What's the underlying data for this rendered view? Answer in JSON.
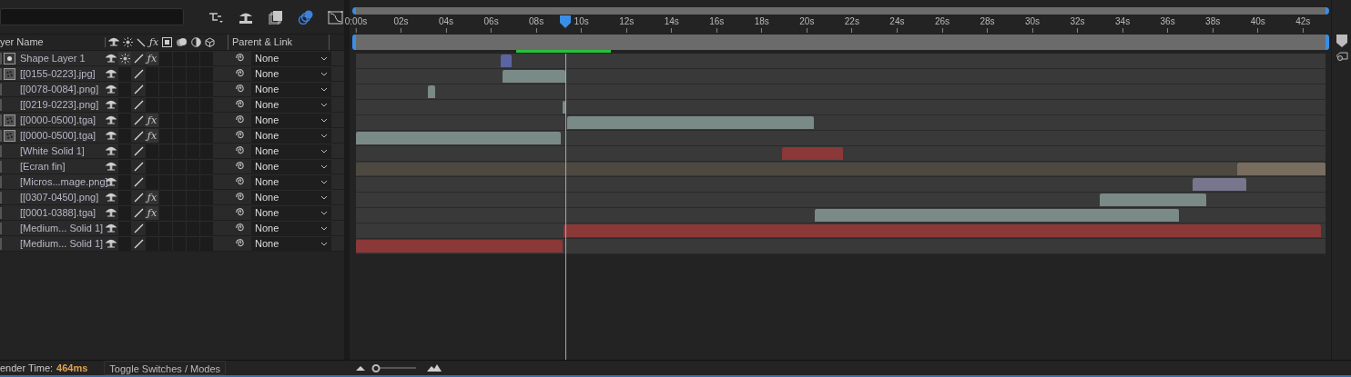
{
  "toolbar": {
    "buttons": [
      {
        "kind": "flowchart",
        "selected": false
      },
      {
        "kind": "shy",
        "selected": false
      },
      {
        "kind": "frame",
        "selected": false
      },
      {
        "kind": "motionblur",
        "selected": true
      },
      {
        "kind": "graph",
        "selected": false
      }
    ]
  },
  "header": {
    "name": "yer Name",
    "fx": "ƒx",
    "parent": "Parent & Link"
  },
  "ruler": {
    "labels": [
      "0:00s",
      "02s",
      "04s",
      "06s",
      "08s",
      "10s",
      "12s",
      "14s",
      "16s",
      "18s",
      "20s",
      "22s",
      "24s",
      "26s",
      "28s",
      "30s",
      "32s",
      "34s",
      "36s",
      "38s",
      "40s",
      "42s"
    ]
  },
  "layers": [
    {
      "name": "Shape Layer 1",
      "kind": "shape",
      "collapse": true,
      "fx": true,
      "fx_label": "ƒx",
      "parent": "None",
      "bars": [
        {
          "color": "#5a64a0"
        }
      ]
    },
    {
      "name": "[[0155-0223].jpg]",
      "kind": "footage",
      "collapse": false,
      "fx": false,
      "parent": "None",
      "bars": [
        {
          "color": "#7a8a86"
        }
      ]
    },
    {
      "name": "[[0078-0084].png]",
      "kind": "none",
      "collapse": false,
      "fx": false,
      "parent": "None",
      "bars": [
        {
          "color": "#7a8a86"
        }
      ]
    },
    {
      "name": "[[0219-0223].png]",
      "kind": "none",
      "collapse": false,
      "fx": false,
      "parent": "None",
      "bars": [
        {
          "color": "#7a8a86"
        }
      ]
    },
    {
      "name": "[[0000-0500].tga]",
      "kind": "footage",
      "collapse": false,
      "fx": true,
      "fx_label": "ƒx",
      "parent": "None",
      "bars": [
        {
          "color": "#7a8a86"
        }
      ]
    },
    {
      "name": "[[0000-0500].tga]",
      "kind": "footage",
      "collapse": false,
      "fx": true,
      "fx_label": "ƒx",
      "parent": "None",
      "bars": [
        {
          "color": "#7a8a86"
        }
      ]
    },
    {
      "name": "[White Solid 1]",
      "kind": "none",
      "collapse": false,
      "fx": false,
      "parent": "None",
      "bars": [
        {
          "color": "#8a3838"
        }
      ]
    },
    {
      "name": "[Ecran fin]",
      "kind": "none",
      "collapse": false,
      "fx": false,
      "parent": "None",
      "bars": [
        {
          "color": "#4d4941"
        },
        {
          "color": "#786d5f"
        }
      ]
    },
    {
      "name": "[Micros...mage.png]",
      "kind": "none",
      "collapse": false,
      "fx": false,
      "parent": "None",
      "bars": [
        {
          "color": "#77768c"
        }
      ]
    },
    {
      "name": "[[0307-0450].png]",
      "kind": "none",
      "collapse": false,
      "fx": true,
      "fx_label": "ƒx",
      "parent": "None",
      "bars": [
        {
          "color": "#7a8a86"
        }
      ]
    },
    {
      "name": "[[0001-0388].tga]",
      "kind": "none",
      "collapse": false,
      "fx": true,
      "fx_label": "ƒx",
      "parent": "None",
      "bars": [
        {
          "color": "#7a8a86"
        }
      ]
    },
    {
      "name": "[Medium... Solid 1]",
      "kind": "none",
      "collapse": false,
      "fx": false,
      "parent": "None",
      "bars": [
        {
          "color": "#8a3838"
        }
      ]
    },
    {
      "name": "[Medium... Solid 1]",
      "kind": "none",
      "collapse": false,
      "fx": false,
      "parent": "None",
      "bars": [
        {
          "color": "#8a3838"
        }
      ]
    }
  ],
  "footer": {
    "label": "ender Time:",
    "value": "464ms",
    "toggle": "Toggle Switches / Modes",
    "zoom": {
      "level": 0.08
    }
  }
}
